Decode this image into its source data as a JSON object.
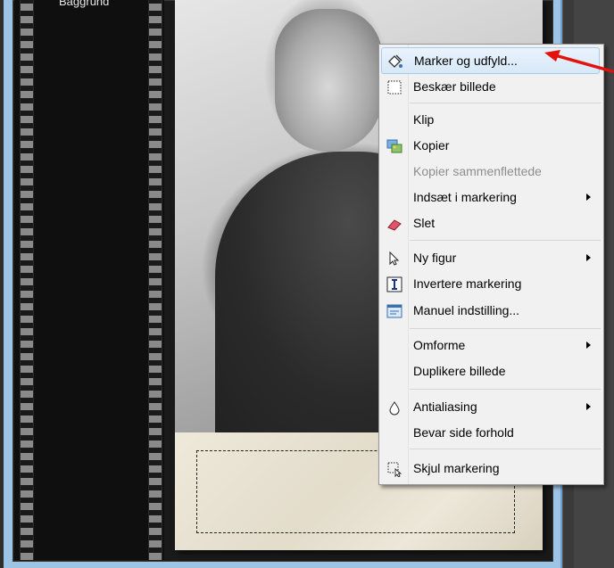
{
  "filmstrip": {
    "label": "Baggrund"
  },
  "menu": {
    "items": [
      {
        "label": "Marker og udfyld...",
        "icon": "fill-select-icon",
        "submenu": false,
        "disabled": false,
        "highlighted": true
      },
      {
        "label": "Beskær billede",
        "icon": "crop-icon",
        "submenu": false,
        "disabled": false
      },
      {
        "label": "Klip",
        "icon": "",
        "submenu": false,
        "disabled": false
      },
      {
        "label": "Kopier",
        "icon": "copy-image-icon",
        "submenu": false,
        "disabled": false
      },
      {
        "label": "Kopier sammenflettede",
        "icon": "",
        "submenu": false,
        "disabled": true
      },
      {
        "label": "Indsæt i markering",
        "icon": "",
        "submenu": true,
        "disabled": false
      },
      {
        "label": "Slet",
        "icon": "eraser-icon",
        "submenu": false,
        "disabled": false
      },
      {
        "label": "Ny figur",
        "icon": "cursor-icon",
        "submenu": true,
        "disabled": false
      },
      {
        "label": "Invertere markering",
        "icon": "invert-selection-icon",
        "submenu": false,
        "disabled": false
      },
      {
        "label": "Manuel indstilling...",
        "icon": "manual-settings-icon",
        "submenu": false,
        "disabled": false
      },
      {
        "label": "Omforme",
        "icon": "",
        "submenu": true,
        "disabled": false
      },
      {
        "label": "Duplikere billede",
        "icon": "",
        "submenu": false,
        "disabled": false
      },
      {
        "label": "Antialiasing",
        "icon": "droplet-icon",
        "submenu": true,
        "disabled": false
      },
      {
        "label": "Bevar side forhold",
        "icon": "",
        "submenu": false,
        "disabled": false
      },
      {
        "label": "Skjul markering",
        "icon": "hide-selection-icon",
        "submenu": false,
        "disabled": false
      }
    ]
  },
  "colors": {
    "highlight": "#d7e8f8",
    "arrow": "#e3120b",
    "frame": "#9cc4e4"
  }
}
